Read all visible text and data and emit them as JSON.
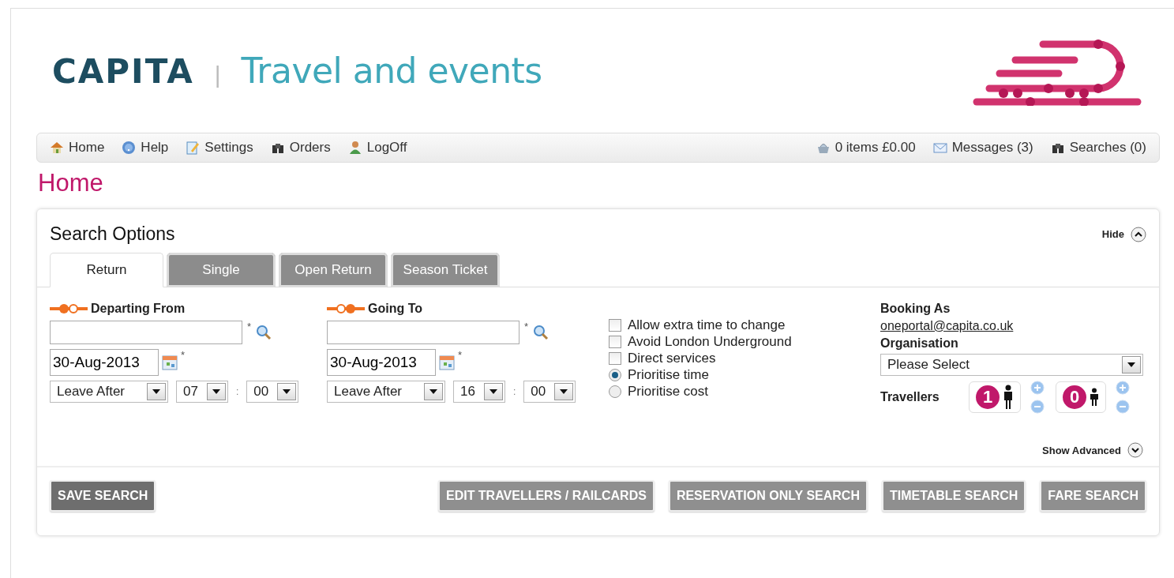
{
  "header": {
    "brand": "CAPITA",
    "separator": "|",
    "product": "Travel and events"
  },
  "nav": {
    "left": [
      {
        "label": "Home"
      },
      {
        "label": "Help"
      },
      {
        "label": "Settings"
      },
      {
        "label": "Orders"
      },
      {
        "label": "LogOff"
      }
    ],
    "right": [
      {
        "label": "0 items £0.00"
      },
      {
        "label": "Messages (3)"
      },
      {
        "label": "Searches (0)"
      }
    ]
  },
  "page_title": "Home",
  "panel": {
    "title": "Search Options",
    "toggle": "Hide",
    "tabs": [
      {
        "label": "Return",
        "selected": true
      },
      {
        "label": "Single",
        "selected": false
      },
      {
        "label": "Open Return",
        "selected": false
      },
      {
        "label": "Season Ticket",
        "selected": false
      }
    ],
    "journeys": [
      {
        "label": "Departing From",
        "required_mark": "*",
        "date": "30-Aug-2013",
        "date_required_mark": "*",
        "time_mode": "Leave After",
        "hour": "07",
        "separator": ":",
        "minute": "00"
      },
      {
        "label": "Going To",
        "required_mark": "*",
        "date": "30-Aug-2013",
        "date_required_mark": "*",
        "time_mode": "Leave After",
        "hour": "16",
        "separator": ":",
        "minute": "00"
      }
    ],
    "options": [
      {
        "kind": "checkbox",
        "label": "Allow extra time to change",
        "checked": false
      },
      {
        "kind": "checkbox",
        "label": "Avoid London Underground",
        "checked": false
      },
      {
        "kind": "checkbox",
        "label": "Direct services",
        "checked": false
      },
      {
        "kind": "radio",
        "label": "Prioritise time",
        "selected": true
      },
      {
        "kind": "radio",
        "label": "Prioritise cost",
        "selected": false
      }
    ],
    "booking": {
      "label": "Booking As",
      "email": "oneportal@capita.co.uk",
      "organisation_label": "Organisation",
      "organisation_value": "Please Select",
      "travellers_label": "Travellers",
      "travellers": [
        {
          "kind": "adult",
          "count": "1"
        },
        {
          "kind": "child",
          "count": "0"
        }
      ]
    },
    "advanced": "Show Advanced",
    "buttons": [
      {
        "label": "SAVE SEARCH",
        "disabled": false
      },
      {
        "label": "EDIT TRAVELLERS / RAILCARDS",
        "disabled": true
      },
      {
        "label": "RESERVATION ONLY SEARCH",
        "disabled": true
      },
      {
        "label": "TIMETABLE SEARCH",
        "disabled": true
      },
      {
        "label": "FARE SEARCH",
        "disabled": true
      }
    ]
  }
}
